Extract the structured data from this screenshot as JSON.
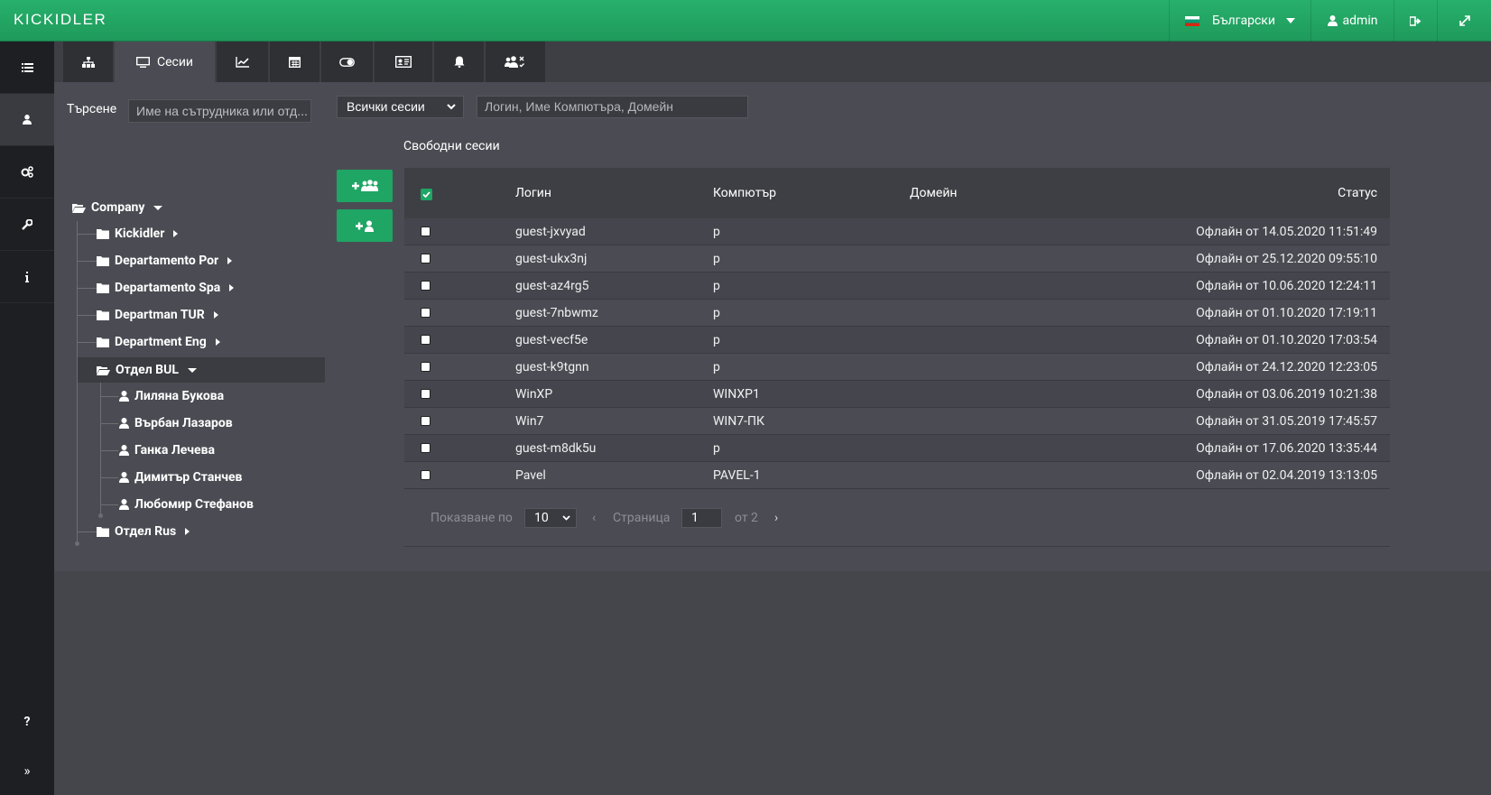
{
  "app": {
    "logo": "KICKIDLER"
  },
  "topbar": {
    "language": "Български",
    "user": "admin"
  },
  "tabs": [
    {
      "icon": "sitemap-icon",
      "label": ""
    },
    {
      "icon": "monitor-icon",
      "label": "Сесии"
    },
    {
      "icon": "chart-line-icon",
      "label": ""
    },
    {
      "icon": "calendar-icon",
      "label": ""
    },
    {
      "icon": "toggle-icon",
      "label": ""
    },
    {
      "icon": "id-card-icon",
      "label": ""
    },
    {
      "icon": "bell-icon",
      "label": ""
    },
    {
      "icon": "users-x-icon",
      "label": ""
    }
  ],
  "search": {
    "label": "Търсене",
    "placeholder": "Име на сътрудника или отд..."
  },
  "tree": {
    "root": "Company",
    "departments": [
      "Kickidler",
      "Departamento Por",
      "Departamento Spa",
      "Departman TUR",
      "Department Eng",
      "Отдел BUL",
      "Отдел Rus"
    ],
    "employees": [
      "Лиляна Букова",
      "Върбан Лазаров",
      "Ганка Лечева",
      "Димитър Станчев",
      "Любомир Стефанов"
    ]
  },
  "filters": {
    "session_filter": "Всички сесии",
    "search_placeholder": "Логин, Име Компютъра, Домейн"
  },
  "sessions": {
    "title": "Свободни сесии",
    "columns": {
      "login": "Логин",
      "computer": "Компютър",
      "domain": "Домейн",
      "status": "Статус"
    },
    "rows": [
      {
        "login": "guest-jxvyad",
        "computer": "p",
        "domain": "",
        "status": "Офлайн от 14.05.2020 11:51:49"
      },
      {
        "login": "guest-ukx3nj",
        "computer": "p",
        "domain": "",
        "status": "Офлайн от 25.12.2020 09:55:10"
      },
      {
        "login": "guest-az4rg5",
        "computer": "p",
        "domain": "",
        "status": "Офлайн от 10.06.2020 12:24:11"
      },
      {
        "login": "guest-7nbwmz",
        "computer": "p",
        "domain": "",
        "status": "Офлайн от 01.10.2020 17:19:11"
      },
      {
        "login": "guest-vecf5e",
        "computer": "p",
        "domain": "",
        "status": "Офлайн от 01.10.2020 17:03:54"
      },
      {
        "login": "guest-k9tgnn",
        "computer": "p",
        "domain": "",
        "status": "Офлайн от 24.12.2020 12:23:05"
      },
      {
        "login": "WinXP",
        "computer": "WINXP1",
        "domain": "",
        "status": "Офлайн от 03.06.2019 10:21:38"
      },
      {
        "login": "Win7",
        "computer": "WIN7-ПК",
        "domain": "",
        "status": "Офлайн от 31.05.2019 17:45:57"
      },
      {
        "login": "guest-m8dk5u",
        "computer": "p",
        "domain": "",
        "status": "Офлайн от 17.06.2020 13:35:44"
      },
      {
        "login": "Pavel",
        "computer": "PAVEL-1",
        "domain": "",
        "status": "Офлайн от 02.04.2019 13:13:05"
      }
    ]
  },
  "pagination": {
    "show_label": "Показване по",
    "per_page": "10",
    "prev": "‹",
    "page_label": "Страница",
    "page": "1",
    "of_label": "от 2",
    "next": "›"
  },
  "colors": {
    "accent": "#1fa564",
    "topbar": "#23a565",
    "background": "#4b4c53",
    "rail": "#1e1f22"
  }
}
